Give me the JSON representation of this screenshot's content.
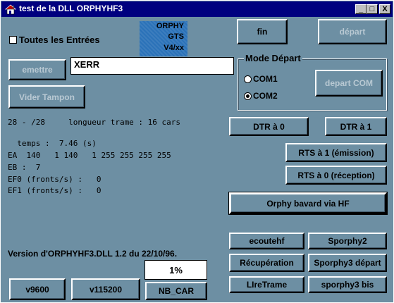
{
  "window": {
    "title": "test de la DLL ORPHYHF3",
    "minimize_glyph": "_",
    "maximize_glyph": "□",
    "close_glyph": "X"
  },
  "checkbox": {
    "label": "Toutes les Entrées",
    "checked": false
  },
  "badge": {
    "line1": "ORPHY",
    "line2": "GTS",
    "line3": "V4/xx"
  },
  "buttons": {
    "fin": "fin",
    "depart": "départ",
    "emettre": "emettre",
    "vider_tampon": "Vider Tampon",
    "depart_com": "depart COM",
    "dtr0": "DTR à 0",
    "dtr1": "DTR à 1",
    "rts1": "RTS à 1 (émission)",
    "rts0": "RTS à 0 (réception)",
    "orphy_bavard": "Orphy bavard via HF",
    "ecoutehf": "ecoutehf",
    "sporphy2": "Sporphy2",
    "recuperation": "Récupération",
    "sporphy3_depart": "Sporphy3 départ",
    "liretrame": "LIreTrame",
    "sporphy3_bis": "sporphy3 bis",
    "v9600": "v9600",
    "v115200": "v115200",
    "nb_car": "NB_CAR"
  },
  "emit_input": {
    "value": "XERR"
  },
  "mode_depart": {
    "title": "Mode Départ",
    "options": [
      "COM1",
      "COM2"
    ],
    "selected": "COM2"
  },
  "info": {
    "line1": "28 - /28     longueur trame : 16 cars",
    "line2": "  temps :  7.46 (s)",
    "line3": "EA  140   1 140   1 255 255 255 255",
    "line4": "EB :  7",
    "line5": "EF0 (fronts/s) :   0",
    "line6": "EF1 (fronts/s) :   0"
  },
  "version": "Version d'ORPHYHF3.DLL 1.2 du 22/10/96.",
  "progress": {
    "value": "1%"
  },
  "colors": {
    "background": "#6d8fa3",
    "titlebar": "#00007f",
    "badge": "#2b72b8"
  }
}
